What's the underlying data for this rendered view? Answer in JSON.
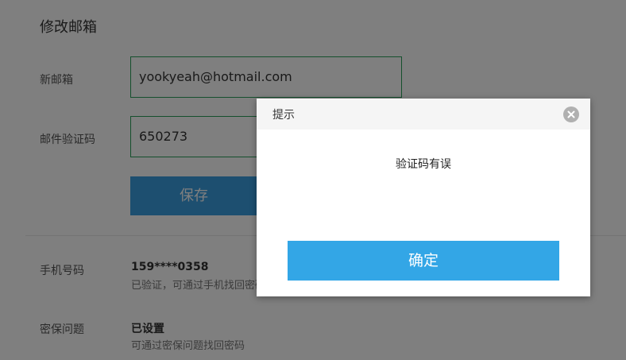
{
  "section": {
    "title": "修改邮箱"
  },
  "form": {
    "new_email_label": "新邮箱",
    "new_email_value": "yookyeah@hotmail.com",
    "code_label": "邮件验证码",
    "code_value": "650273",
    "save_label": "保存"
  },
  "account": {
    "phone": {
      "label": "手机号码",
      "value": "159****0358",
      "desc": "已验证，可通过手机找回密码"
    },
    "security_question": {
      "label": "密保问题",
      "value": "已设置",
      "desc": "可通过密保问题找回密码"
    }
  },
  "dialog": {
    "title": "提示",
    "message": "验证码有误",
    "confirm_label": "确定",
    "close_icon": "close-icon"
  },
  "colors": {
    "accent": "#33a6e6",
    "input_border": "#2aa05a",
    "overlay": "rgba(0,0,0,0.5)"
  }
}
